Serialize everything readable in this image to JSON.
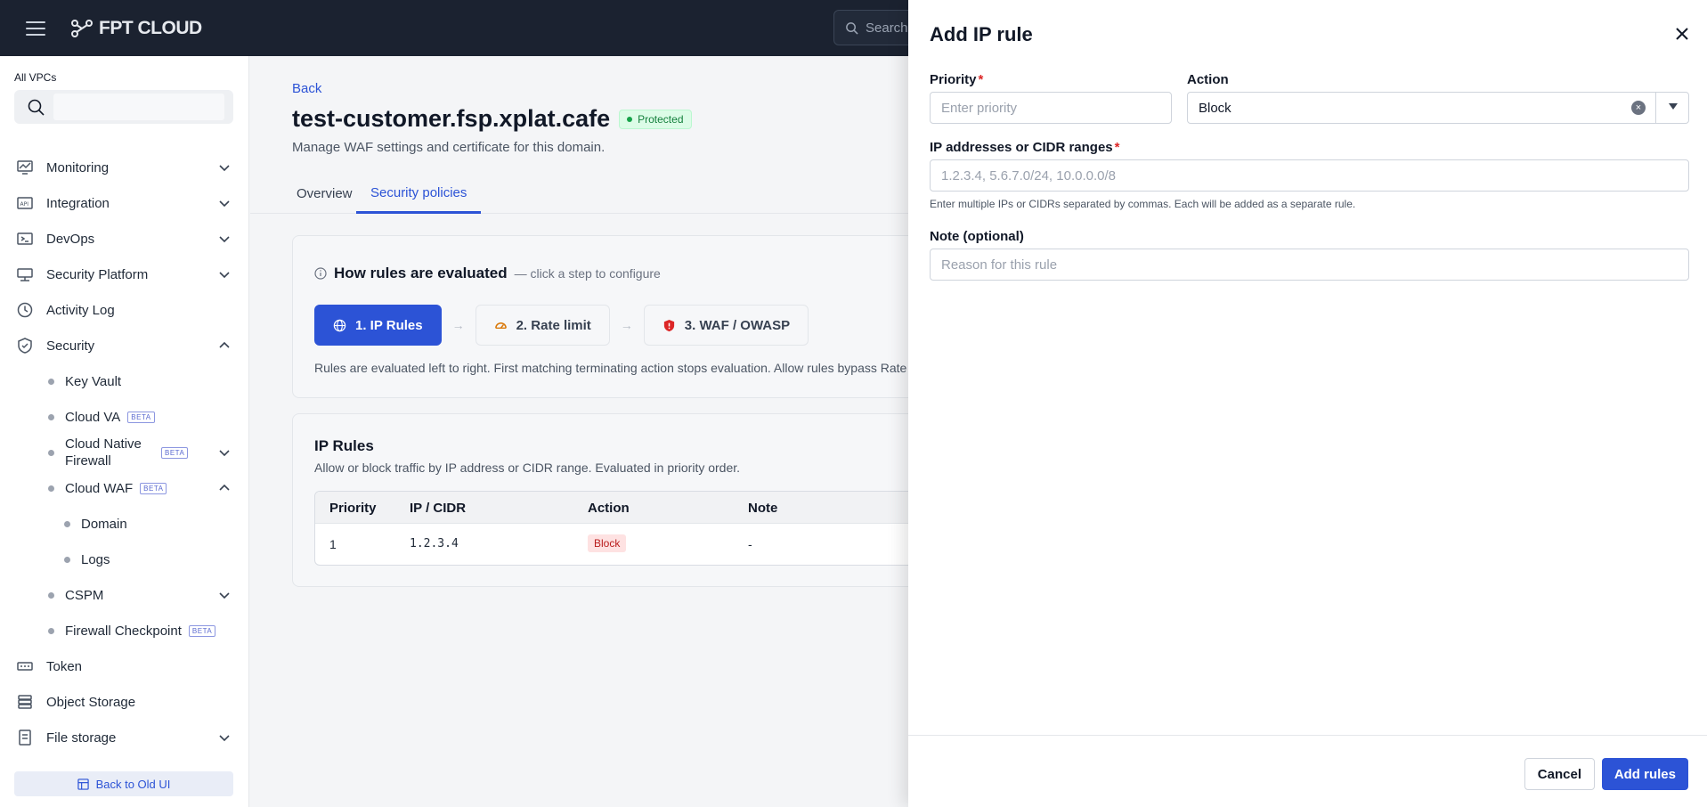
{
  "header": {
    "logo_text": "FPT CLOUD",
    "search_placeholder": "Search"
  },
  "sidebar": {
    "vpc_label": "All VPCs",
    "items": [
      {
        "label": "Monitoring",
        "icon": "monitoring-icon"
      },
      {
        "label": "Integration",
        "icon": "api-icon"
      },
      {
        "label": "DevOps",
        "icon": "devops-icon"
      },
      {
        "label": "Security Platform",
        "icon": "network-icon"
      },
      {
        "label": "Activity Log",
        "icon": "clock-icon"
      },
      {
        "label": "Security",
        "icon": "shield-icon"
      },
      {
        "label": "Token",
        "icon": "token-icon"
      },
      {
        "label": "Object Storage",
        "icon": "storage-icon"
      },
      {
        "label": "File storage",
        "icon": "file-icon"
      }
    ],
    "security_children": [
      {
        "label": "Key Vault"
      },
      {
        "label": "Cloud VA",
        "badge": "BETA"
      },
      {
        "label": "Cloud Native Firewall",
        "badge": "BETA"
      },
      {
        "label": "Cloud WAF",
        "badge": "BETA"
      },
      {
        "label": "Domain"
      },
      {
        "label": "Logs"
      },
      {
        "label": "CSPM"
      },
      {
        "label": "Firewall Checkpoint",
        "badge": "BETA"
      }
    ],
    "back_to_old": "Back to Old UI"
  },
  "main": {
    "back": "Back",
    "title": "test-customer.fsp.xplat.cafe",
    "status": "Protected",
    "subtitle": "Manage WAF settings and certificate for this domain.",
    "tabs": [
      {
        "label": "Overview"
      },
      {
        "label": "Security policies"
      }
    ],
    "evaluation": {
      "title": "How rules are evaluated",
      "hint": "— click a step to configure",
      "steps": [
        {
          "label": "1. IP Rules"
        },
        {
          "label": "2. Rate limit"
        },
        {
          "label": "3. WAF / OWASP"
        }
      ],
      "note": "Rules are evaluated left to right. First matching terminating action stops evaluation. Allow rules bypass Rate L"
    },
    "ip_rules": {
      "title": "IP Rules",
      "subtitle": "Allow or block traffic by IP address or CIDR range. Evaluated in priority order.",
      "columns": [
        "Priority",
        "IP / CIDR",
        "Action",
        "Note"
      ],
      "rows": [
        {
          "priority": "1",
          "ip": "1.2.3.4",
          "action": "Block",
          "note": "-"
        }
      ]
    }
  },
  "drawer": {
    "title": "Add IP rule",
    "priority_label": "Priority",
    "priority_placeholder": "Enter priority",
    "action_label": "Action",
    "action_value": "Block",
    "ip_label": "IP addresses or CIDR ranges",
    "ip_placeholder": "1.2.3.4, 5.6.7.0/24, 10.0.0.0/8",
    "ip_help": "Enter multiple IPs or CIDRs separated by commas. Each will be added as a separate rule.",
    "note_label": "Note (optional)",
    "note_placeholder": "Reason for this rule",
    "cancel": "Cancel",
    "submit": "Add rules",
    "required_mark": "*"
  },
  "colors": {
    "accent": "#2c53d6",
    "topbar": "#1b2230",
    "danger": "#dc2626",
    "success": "#16a34a"
  }
}
